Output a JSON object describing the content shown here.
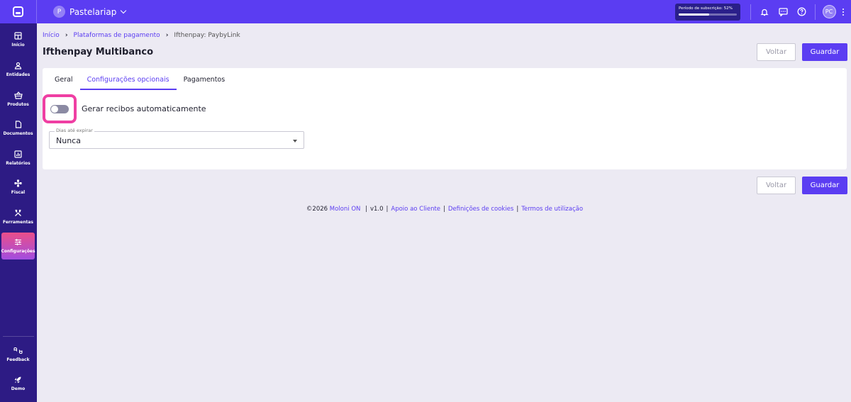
{
  "topbar": {
    "company_initial": "P",
    "company_name": "Pastelariap",
    "subscription_label": "Período de subscrição: 52%",
    "subscription_progress": 0.52,
    "user_initials": "PC",
    "brand_color": "#5b3df2"
  },
  "sidebar": {
    "items": [
      {
        "label": "Início",
        "icon": "dashboard-icon"
      },
      {
        "label": "Entidades",
        "icon": "user-icon"
      },
      {
        "label": "Produtos",
        "icon": "basket-icon"
      },
      {
        "label": "Documentos",
        "icon": "document-icon"
      },
      {
        "label": "Relatórios",
        "icon": "chart-icon"
      },
      {
        "label": "Fiscal",
        "icon": "fiscal-icon"
      },
      {
        "label": "Ferramentas",
        "icon": "tools-icon"
      },
      {
        "label": "Configurações",
        "icon": "sliders-icon"
      }
    ],
    "active": "Configurações",
    "bottom_items": [
      {
        "label": "Feedback",
        "icon": "feedback-icon"
      },
      {
        "label": "Demo",
        "icon": "rocket-icon"
      }
    ],
    "background": "#2d1b84"
  },
  "breadcrumb": {
    "home": "Início",
    "parent": "Plataformas de pagamento",
    "current": "Ifthenpay: PaybyLink"
  },
  "page": {
    "title": "Ifthenpay Multibanco",
    "back_label": "Voltar",
    "save_label": "Guardar"
  },
  "tabs": [
    {
      "label": "Geral"
    },
    {
      "label": "Configurações opcionais"
    },
    {
      "label": "Pagamentos"
    }
  ],
  "active_tab": "Configurações opcionais",
  "form": {
    "toggle_label": "Gerar recibos automaticamente",
    "toggle_state": false,
    "expiry_legend": "Dias até expirar",
    "expiry_value": "Nunca"
  },
  "footer": {
    "copyright": "©2026",
    "brand": "Moloni ON",
    "version": "v1.0",
    "links": [
      "Apoio ao Cliente",
      "Definições de cookies",
      "Termos de utilização"
    ]
  }
}
